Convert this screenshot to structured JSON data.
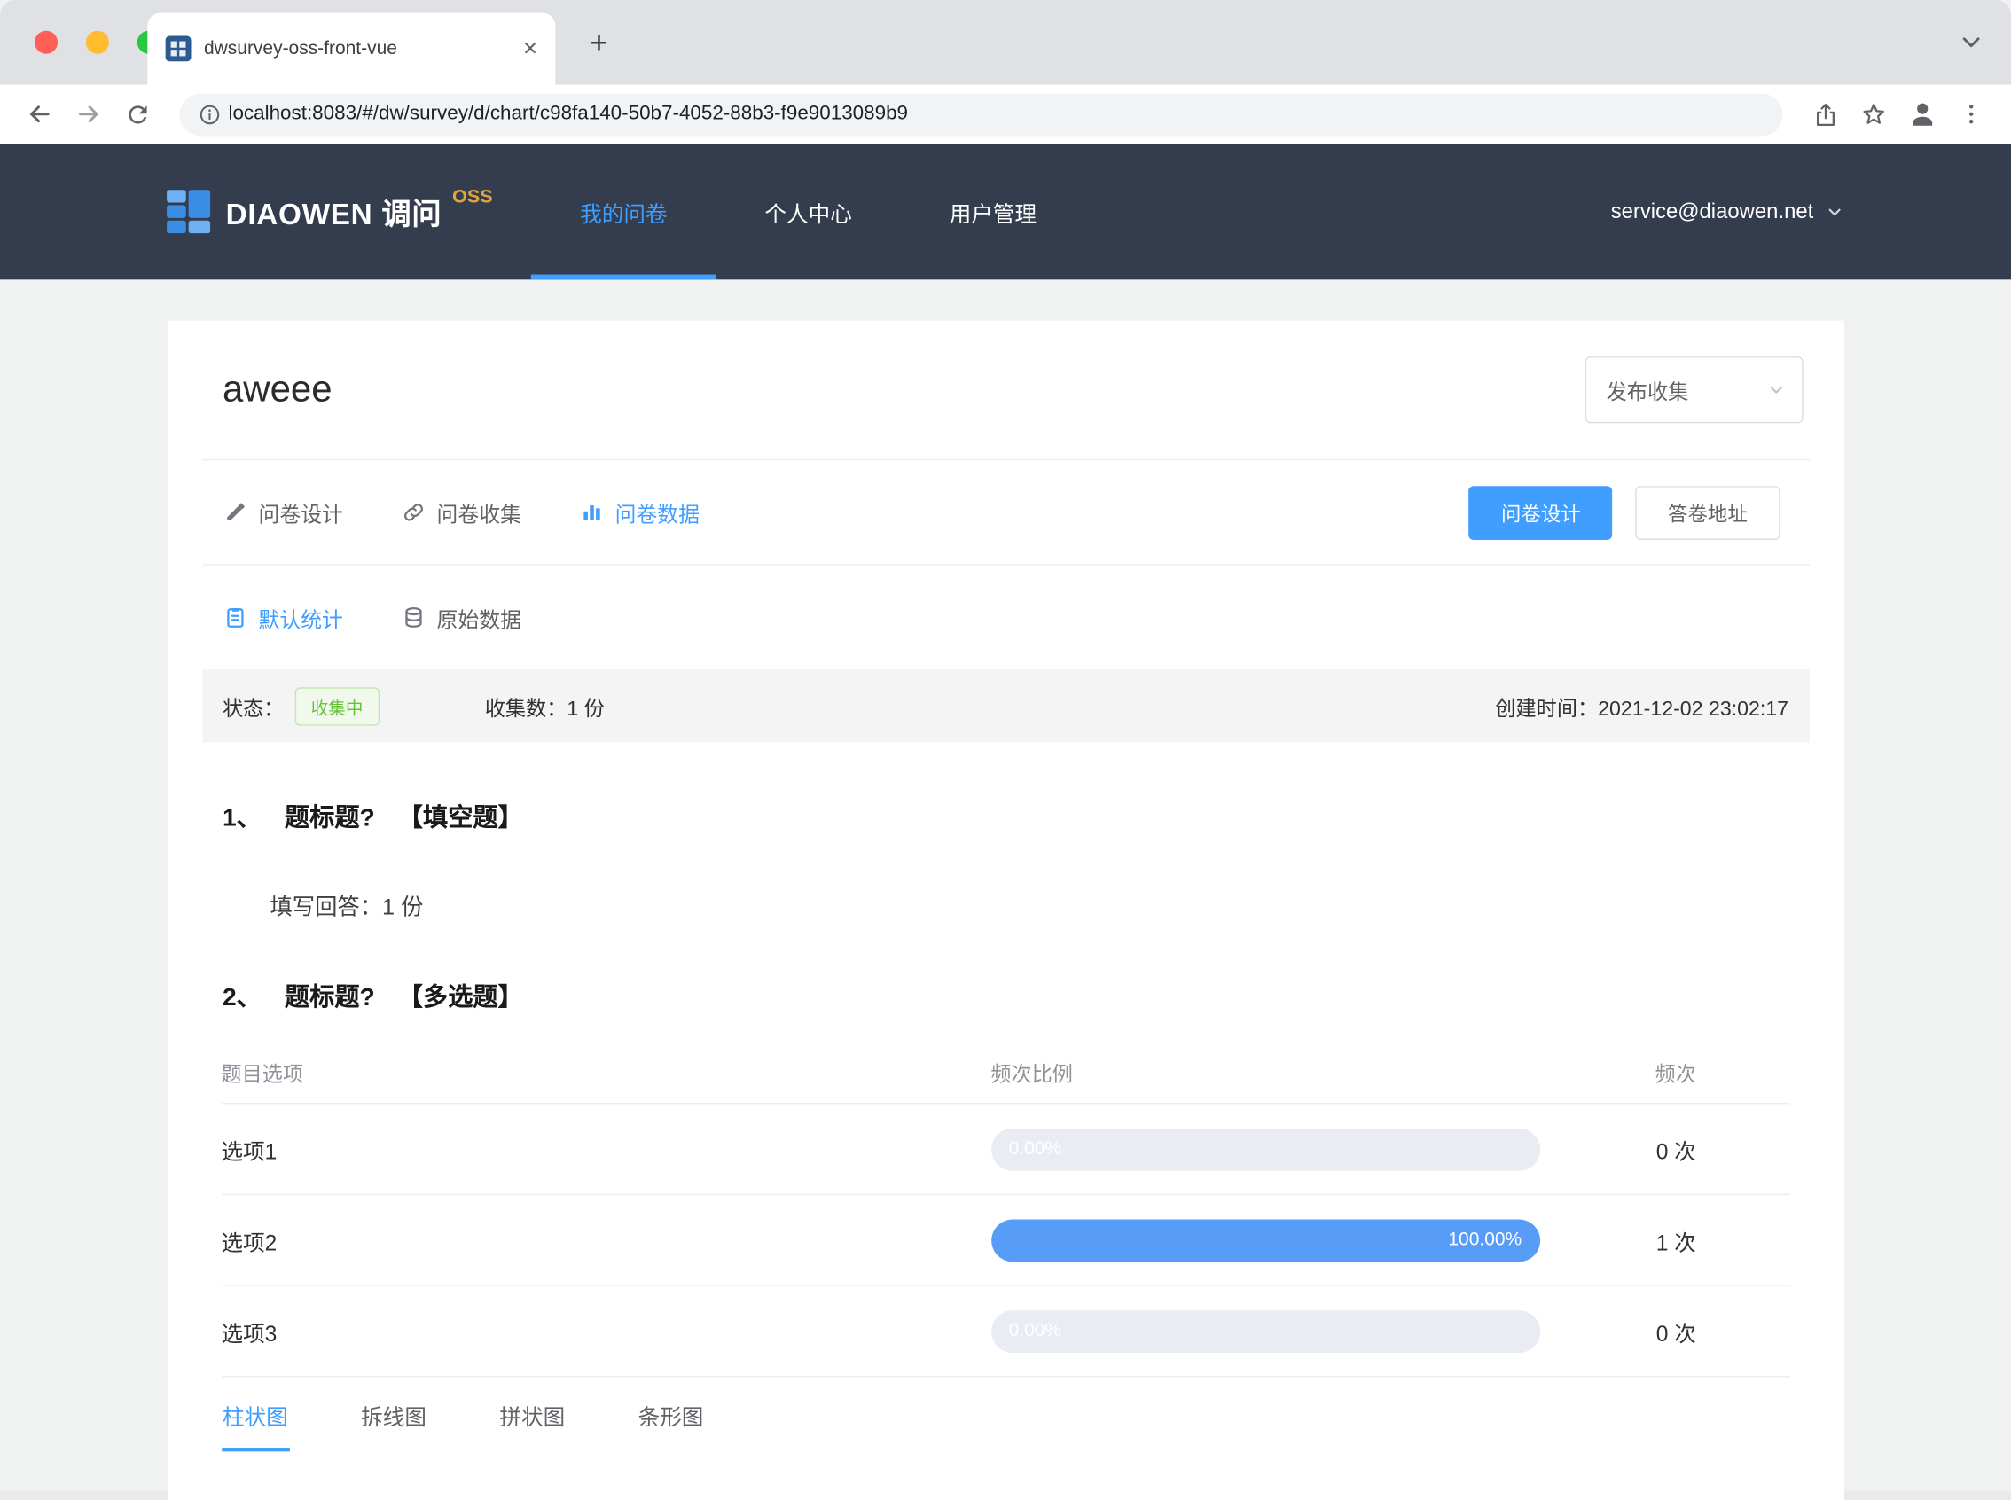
{
  "browser": {
    "tab_title": "dwsurvey-oss-front-vue",
    "close_glyph": "×",
    "new_tab_glyph": "+",
    "url": "localhost:8083/#/dw/survey/d/chart/c98fa140-50b7-4052-88b3-f9e9013089b9"
  },
  "appbar": {
    "brand": "DIAOWEN 调问",
    "brand_badge": "OSS",
    "nav": [
      {
        "label": "我的问卷"
      },
      {
        "label": "个人中心"
      },
      {
        "label": "用户管理"
      }
    ],
    "account": "service@diaowen.net"
  },
  "page": {
    "title": "aweee",
    "publish_dropdown": "发布收集",
    "section_tabs": [
      {
        "label": "问卷设计"
      },
      {
        "label": "问卷收集"
      },
      {
        "label": "问卷数据"
      }
    ],
    "buttons": {
      "design": "问卷设计",
      "answer_address": "答卷地址"
    },
    "stat_tabs": [
      {
        "label": "默认统计"
      },
      {
        "label": "原始数据"
      }
    ],
    "status_bar": {
      "status_label": "状态：",
      "status_badge": "收集中",
      "count_label": "收集数：",
      "count_value": "1 份",
      "created_label": "创建时间：",
      "created_value": "2021-12-02 23:02:17"
    },
    "question1": {
      "num": "1、",
      "title": "题标题?",
      "type": "【填空题】",
      "answer_label": "填写回答：",
      "answer_value": "1 份"
    },
    "question2": {
      "num": "2、",
      "title": "题标题?",
      "type": "【多选题】"
    },
    "chart_data": {
      "type": "table",
      "headers": [
        "题目选项",
        "频次比例",
        "频次"
      ],
      "rows": [
        {
          "option": "选项1",
          "percent": 0,
          "percent_label": "0.00%",
          "count": "0 次"
        },
        {
          "option": "选项2",
          "percent": 100,
          "percent_label": "100.00%",
          "count": "1 次"
        },
        {
          "option": "选项3",
          "percent": 0,
          "percent_label": "0.00%",
          "count": "0 次"
        }
      ]
    },
    "chart_tabs": [
      {
        "label": "柱状图"
      },
      {
        "label": "拆线图"
      },
      {
        "label": "拼状图"
      },
      {
        "label": "条形图"
      }
    ]
  },
  "colors": {
    "accent_blue": "#409eff",
    "bar_fill": "#579df8",
    "bar_track": "#e9edf3",
    "badge_green_text": "#67c23a",
    "badge_green_bg": "#f0f9eb",
    "header_bg": "#333d4e",
    "oss_badge": "#e6a23c",
    "traffic_red": "#ff5f57",
    "traffic_yellow": "#febc2e",
    "traffic_green": "#28c840"
  }
}
